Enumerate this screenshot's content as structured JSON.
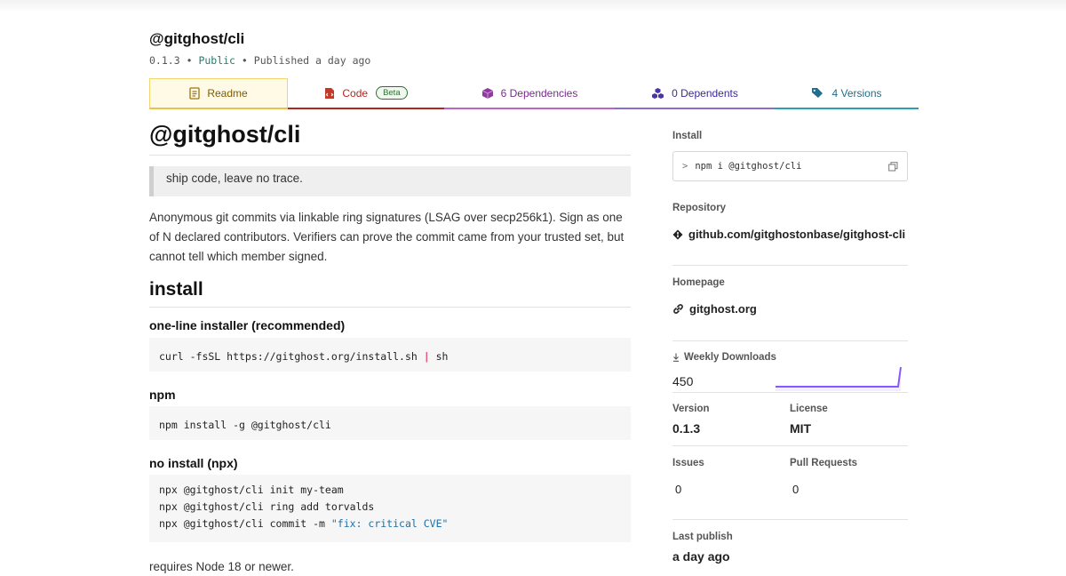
{
  "package": {
    "name": "@gitghost/cli",
    "version": "0.1.3",
    "visibility": "Public",
    "published": "Published a day ago",
    "separator": "•"
  },
  "tabs": {
    "readme": "Readme",
    "code": "Code",
    "code_badge": "Beta",
    "dependencies": "6 Dependencies",
    "dependents": "0 Dependents",
    "versions": "4 Versions"
  },
  "readme": {
    "title": "@gitghost/cli",
    "quote": "ship code, leave no trace.",
    "description": "Anonymous git commits via linkable ring signatures (LSAG over secp256k1). Sign as one of N declared contributors. Verifiers can prove the commit came from your trusted set, but cannot tell which member signed.",
    "install_heading": "install",
    "oneline_heading": "one-line installer (recommended)",
    "oneline_cmd_a": "curl -fsSL https://gitghost.org/install.sh ",
    "oneline_pipe": "|",
    "oneline_cmd_b": " sh",
    "npm_heading": "npm",
    "npm_cmd": "npm install -g @gitghost/cli",
    "npx_heading": "no install (npx)",
    "npx_line1": "npx @gitghost/cli init my-team",
    "npx_line2": "npx @gitghost/cli ring add torvalds",
    "npx_line3_a": "npx @gitghost/cli commit -m ",
    "npx_line3_str": "\"fix: critical CVE\"",
    "requirement": "requires Node 18 or newer."
  },
  "sidebar": {
    "install_label": "Install",
    "install_prompt": ">",
    "install_cmd": "npm i @gitghost/cli",
    "repository_label": "Repository",
    "repository": "github.com/gitghostonbase/gitghost-cli",
    "homepage_label": "Homepage",
    "homepage": "gitghost.org",
    "weekly_label": "Weekly Downloads",
    "weekly_value": "450",
    "version_label": "Version",
    "version": "0.1.3",
    "license_label": "License",
    "license": "MIT",
    "issues_label": "Issues",
    "issues": "0",
    "pulls_label": "Pull Requests",
    "pulls": "0",
    "last_publish_label": "Last publish",
    "last_publish": "a day ago"
  },
  "colors": {
    "accent_readme": "#e8c24c",
    "accent_code": "#b2261e",
    "accent_deps": "#c062c9",
    "accent_dependents": "#8b6bd1",
    "accent_versions": "#2ba0b5",
    "sparkline": "#8956ff",
    "public": "#237a6b"
  },
  "icons": {
    "readme": "document-icon",
    "code": "file-code-icon",
    "dependencies": "box-icon",
    "dependents": "boxes-icon",
    "versions": "tags-icon",
    "copy": "copy-icon",
    "repository": "git-diamond-icon",
    "homepage": "link-icon",
    "downloads": "download-arrow-icon"
  }
}
